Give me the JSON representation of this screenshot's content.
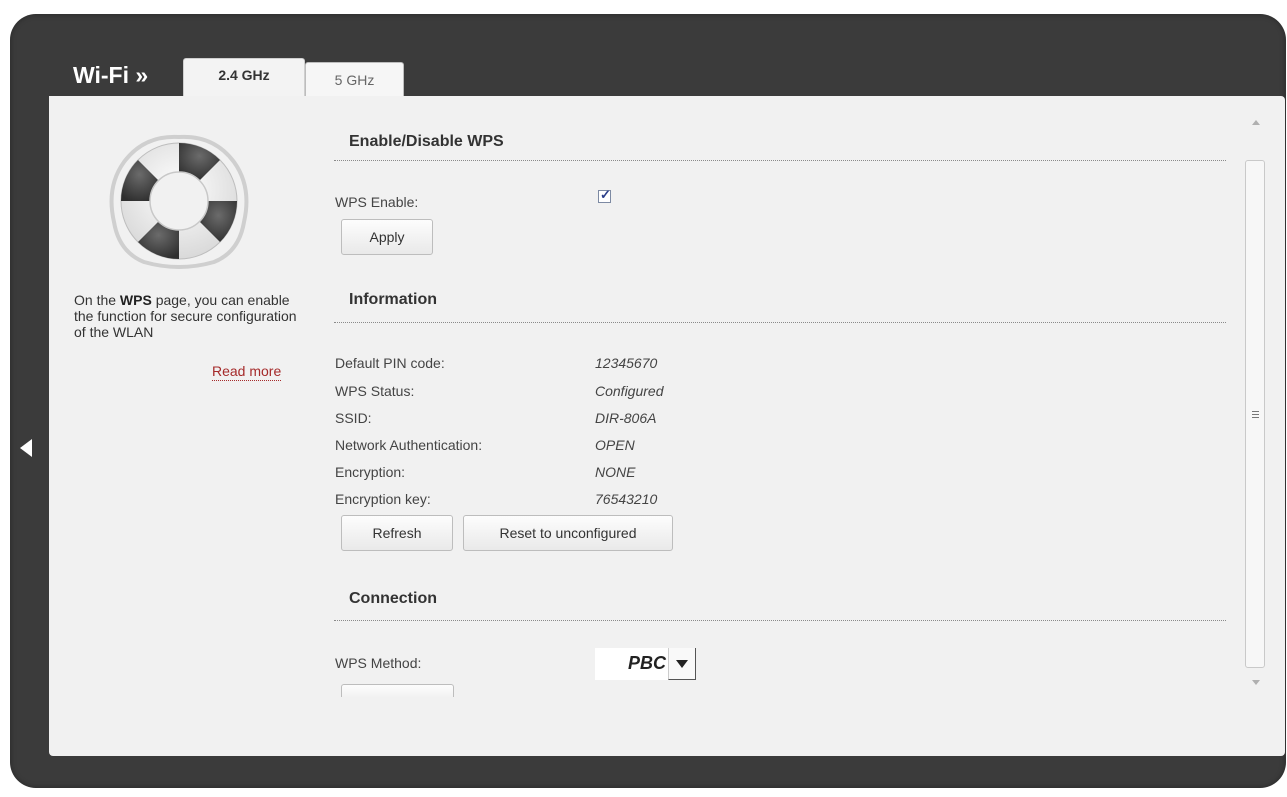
{
  "header": {
    "title": "Wi-Fi »",
    "tabs": [
      {
        "label": "2.4 GHz",
        "active": true
      },
      {
        "label": "5 GHz",
        "active": false
      }
    ]
  },
  "sidebar": {
    "icon": "life-buoy-icon",
    "help_prefix": "On the ",
    "help_bold": "WPS",
    "help_suffix": " page, you can enable the function for secure configuration of the WLAN",
    "read_more": "Read more"
  },
  "enable_section": {
    "title": "Enable/Disable WPS",
    "wps_enable_label": "WPS Enable:",
    "wps_enable_checked": true,
    "apply_label": "Apply"
  },
  "info_section": {
    "title": "Information",
    "rows": [
      {
        "label": "Default PIN code:",
        "value": "12345670"
      },
      {
        "label": "WPS Status:",
        "value": "Configured"
      },
      {
        "label": "SSID:",
        "value": "DIR-806A"
      },
      {
        "label": "Network Authentication:",
        "value": "OPEN"
      },
      {
        "label": "Encryption:",
        "value": "NONE"
      },
      {
        "label": "Encryption key:",
        "value": "76543210"
      }
    ],
    "refresh_label": "Refresh",
    "reset_label": "Reset to unconfigured"
  },
  "connection_section": {
    "title": "Connection",
    "method_label": "WPS Method:",
    "method_value": "PBC"
  },
  "colors": {
    "frame": "#3b3b3b",
    "panel": "#f1f1f1",
    "read_more": "#a52a2a"
  }
}
